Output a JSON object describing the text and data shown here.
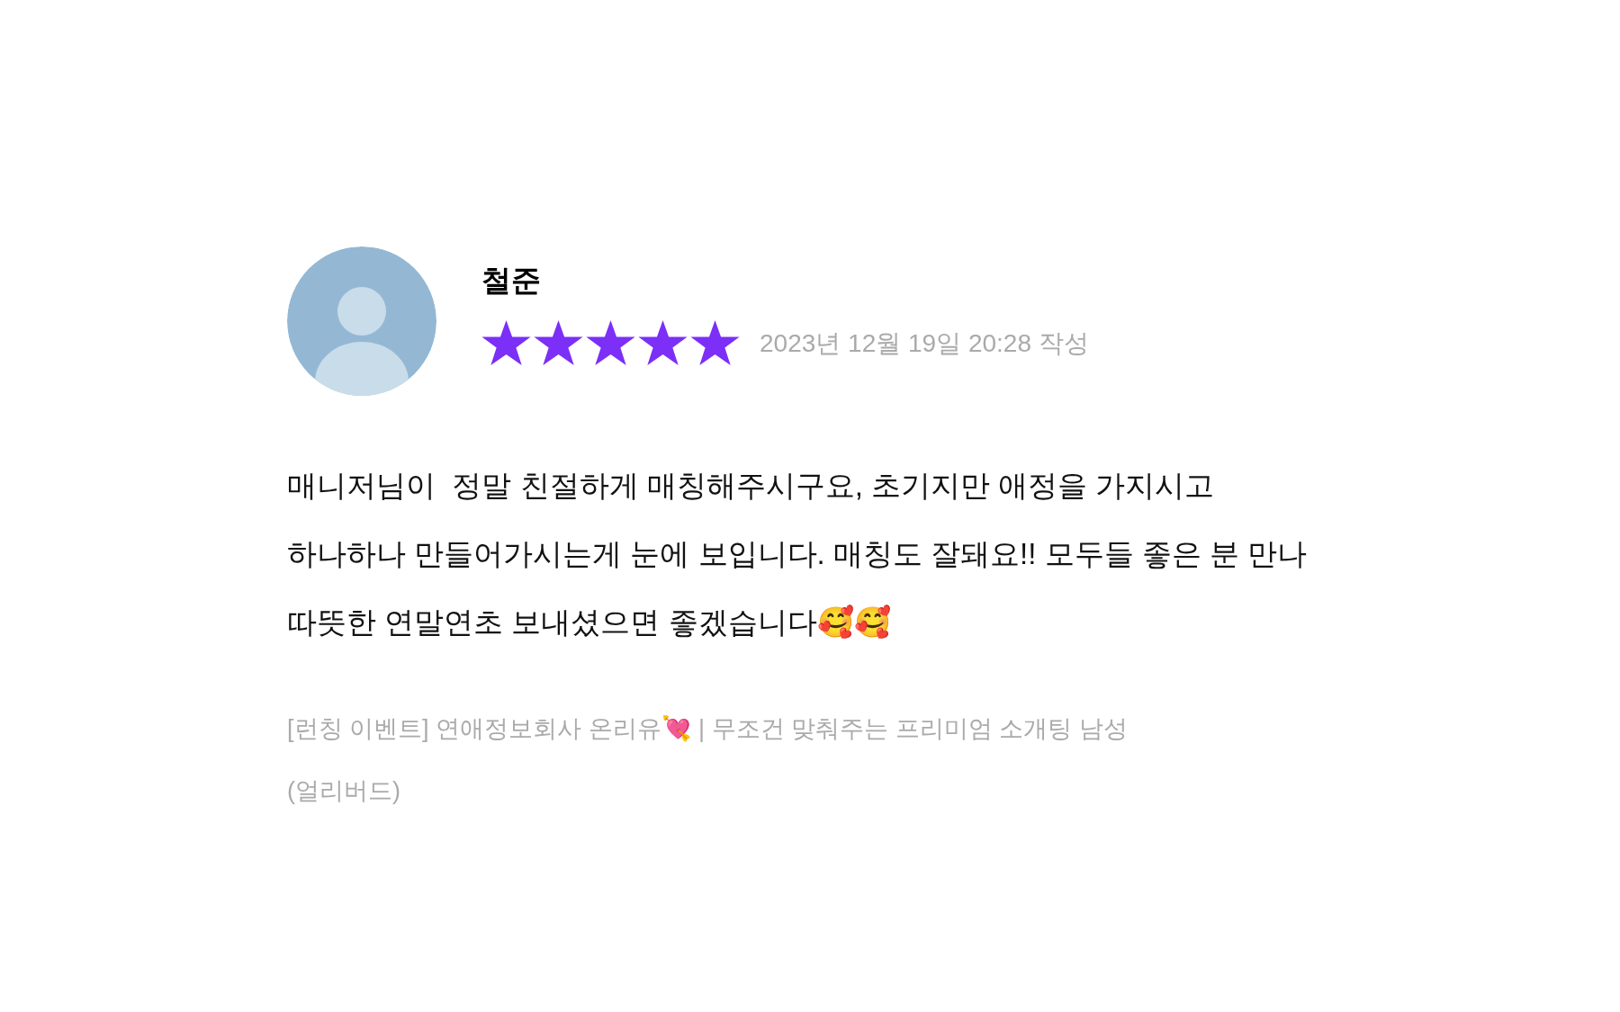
{
  "review": {
    "author": "철준",
    "stars": 5,
    "date": "2023년 12월 19일 20:28 작성",
    "body": "매니저님이  정말 친절하게 매칭해주시구요, 초기지만 애정을 가지시고 하나하나 만들어가시는게 눈에 보입니다. 매칭도 잘돼요!! 모두들 좋은 분 만나 따뜻한 연말연초 보내셨으면 좋겠습니다🥰🥰",
    "product": "[런칭 이벤트] 연애정보회사 온리유💘 | 무조건 맞춰주는 프리미엄 소개팅 남성(얼리버드)"
  }
}
